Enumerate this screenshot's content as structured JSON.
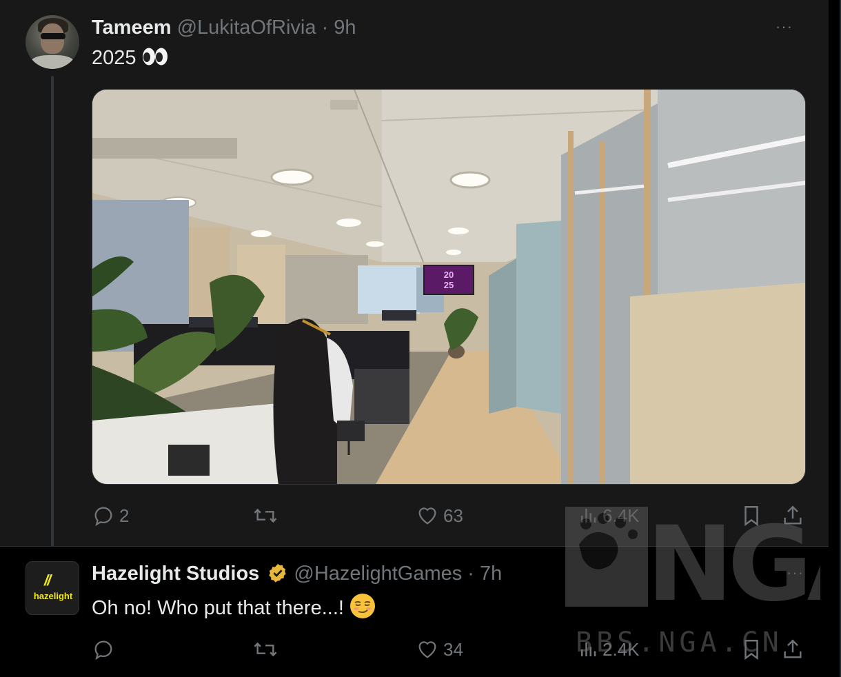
{
  "tweets": [
    {
      "author_name": "Tameem",
      "handle": "@LukitaOfRivia",
      "separator": "·",
      "time": "9h",
      "text": "2025",
      "emoji": "eyes-emoji",
      "media_description": "office-video-frame",
      "actions": {
        "replies": "2",
        "retweets": "",
        "likes": "63",
        "views": "6.4K"
      }
    },
    {
      "author_name": "Hazelight Studios",
      "verified": true,
      "handle": "@HazelightGames",
      "separator": "·",
      "time": "7h",
      "text": "Oh no! Who put that there...!",
      "emoji": "smirking-face-emoji",
      "avatar_text": "hazelight",
      "actions": {
        "replies": "",
        "retweets": "",
        "likes": "34",
        "views": "2.4K"
      }
    }
  ],
  "more_icon": "···",
  "media_screen_text": [
    "20",
    "25"
  ],
  "watermark": {
    "logo_text": "NGA",
    "site_text": "BBS.NGA.CN"
  },
  "colors": {
    "background": "#000000",
    "tweet_bg": "#181818",
    "text": "#e7e9ea",
    "secondary": "#71767b",
    "verified_gold": "#e8b83a",
    "hazelight_yellow": "#f0e71c"
  }
}
